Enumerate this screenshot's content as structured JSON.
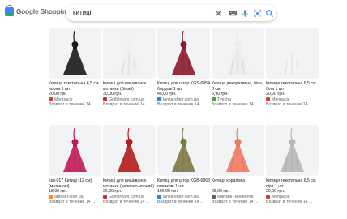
{
  "header": {
    "logo_text": "Google Shopping",
    "search_value": "китиці",
    "icons": [
      "close-icon",
      "keyboard-icon",
      "mic-icon",
      "lens-icon",
      "search-icon"
    ]
  },
  "colors": {
    "accent": "#4285f4",
    "text": "#202124",
    "muted": "#5f6368"
  },
  "products": [
    {
      "title": "Китиця текстильна 6,5 см чорна 1 шт",
      "price": "20,00 грн.",
      "seller": "Monpacie",
      "shipping": "Возврат в течение 14 ...",
      "fav_color": "#e53935",
      "color": "#1a1a1a"
    },
    {
      "title": "Китиці для вишиванок мотанки (Білий)",
      "price": "30,00 грн.",
      "seller": "Golfstream.com.ua",
      "shipping": "Возврат в течение 14 ...",
      "fav_color": "#d32f2f",
      "color": "#f0f0f0"
    },
    {
      "title": "Китиці для штор KGS-6954 бордові 1 шт",
      "price": "45,00 грн.",
      "seller": "lanita-shtor.com.ua",
      "shipping": "Возврат в течение 14 ...",
      "fav_color": "#1e88e5",
      "color": "#8b1a2e"
    },
    {
      "title": "Китиця декоративна, біла, 8 см",
      "price": "5,90 грн.",
      "seller": "Tvecha",
      "shipping": "Возврат в течение 14 ...",
      "fav_color": "#43a047",
      "color": "#ececec"
    },
    {
      "title": "Китиця текстильна 6,5 см біла 1 шт",
      "price": "20,00 грн.",
      "seller": "Monpacie",
      "shipping": "Возврат в течение 14 ...",
      "fav_color": "#e53935",
      "color": "#f4f4f4"
    },
    {
      "title": "kist-017 Китиці (12 см) (малинові)",
      "price": "18,00 грн.",
      "seller": "artbiser.com.ua",
      "shipping": "Возврат в течение 14 ...",
      "fav_color": "#fb8c00",
      "color": "#c2185b"
    },
    {
      "title": "Китиці для вишиванок мотанки (червоно-чорний)",
      "price": "26,00 грн.",
      "seller": "Golfstream.com.ua",
      "shipping": "Возврат в течение 14 ...",
      "fav_color": "#d32f2f",
      "color": "#b71c1c"
    },
    {
      "title": "Китиці для штор KGB-6863 оливкові 1 шт",
      "price": "196,00 грн.",
      "seller": "lanita-shtor.com.ua",
      "shipping": "Возврат в течение 14 ...",
      "fav_color": "#1e88e5",
      "color": "#7d7a45"
    },
    {
      "title": "Китиця коралова",
      "price": "25,00 грн.",
      "seller": "Магазин конвертів",
      "shipping": "Возврат в течение 14 ...",
      "fav_color": "#5f6368",
      "color": "#ef7a62"
    },
    {
      "title": "Китиця текстильна 6,5 см сіра 1 шт",
      "price": "20,00 грн.",
      "seller": "Monpacie",
      "shipping": "Возврат в течение 14 ...",
      "fav_color": "#e53935",
      "color": "#b8b8b8"
    }
  ]
}
